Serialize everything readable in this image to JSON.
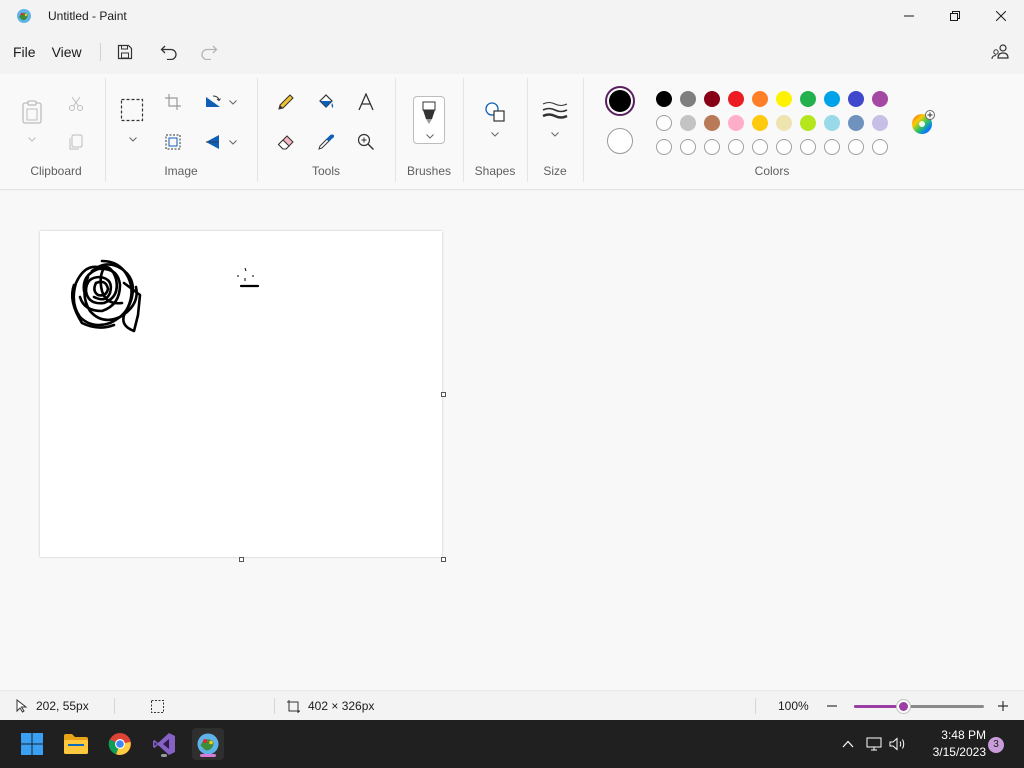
{
  "window": {
    "title": "Untitled - Paint"
  },
  "menu": {
    "file": "File",
    "view": "View"
  },
  "ribbon": {
    "groups": {
      "clipboard": "Clipboard",
      "image": "Image",
      "tools": "Tools",
      "brushes": "Brushes",
      "shapes": "Shapes",
      "size": "Size",
      "colors": "Colors"
    },
    "primary_color": "#000000",
    "secondary_color": "#ffffff",
    "palette_row1": [
      "#000000",
      "#7f7f7f",
      "#880015",
      "#ed1c24",
      "#ff7f27",
      "#fff200",
      "#22b14c",
      "#00a2e8",
      "#3f48cc",
      "#a349a4"
    ],
    "palette_row2": [
      "#ffffff",
      "#c3c3c3",
      "#b97a57",
      "#ffaec9",
      "#ffc90e",
      "#efe4b0",
      "#b5e61d",
      "#99d9ea",
      "#7092be",
      "#c8bfe7"
    ]
  },
  "status": {
    "cursor_pos": "202, 55px",
    "canvas_size": "402 × 326px",
    "zoom": "100%",
    "zoom_fraction": 0.38
  },
  "taskbar": {
    "time": "3:48 PM",
    "date": "3/15/2023",
    "notifications": "3"
  },
  "accent": "#9b3fa5"
}
